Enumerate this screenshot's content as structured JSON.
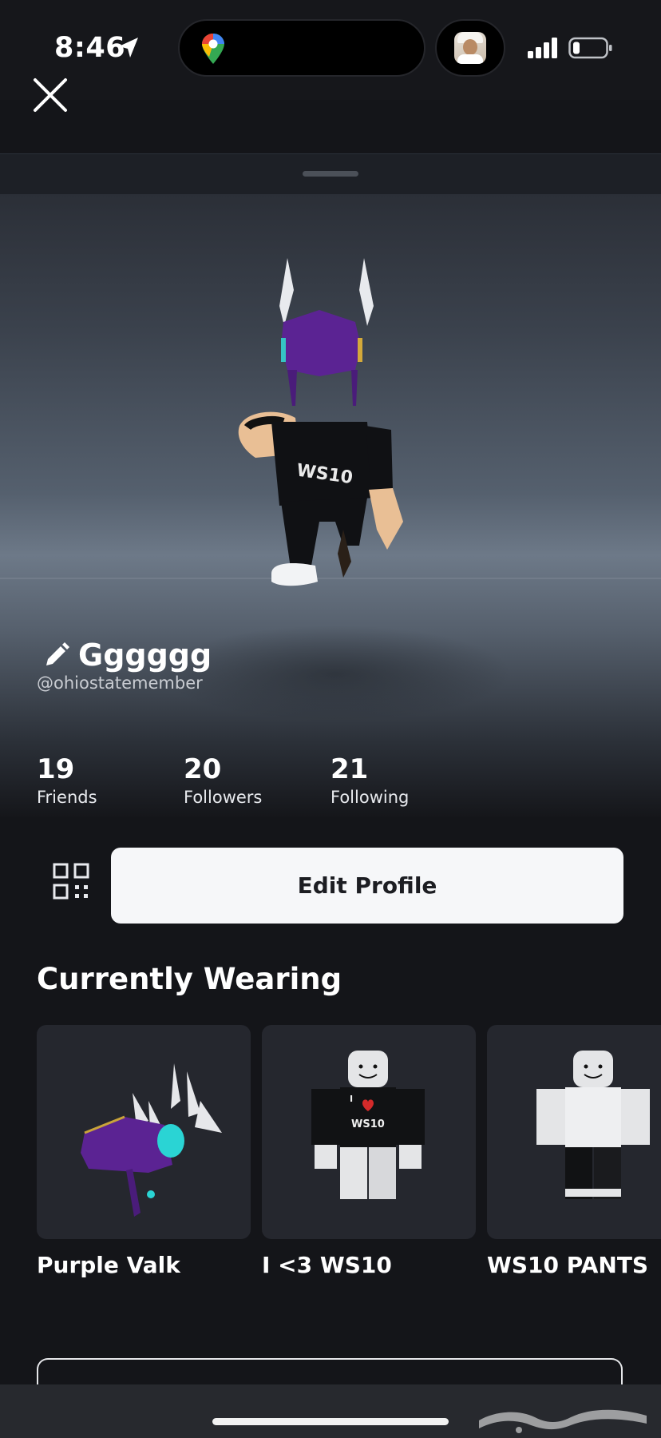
{
  "status_bar": {
    "time": "8:46",
    "icons": [
      "location-arrow-icon",
      "google-maps-icon",
      "contact-avatar-icon",
      "cellular-signal-icon",
      "battery-icon"
    ]
  },
  "header": {
    "close_icon": "close-icon"
  },
  "profile": {
    "display_name": "Gggggg",
    "username": "@ohiostatemember",
    "stats": [
      {
        "value": "19",
        "label": "Friends"
      },
      {
        "value": "20",
        "label": "Followers"
      },
      {
        "value": "21",
        "label": "Following"
      }
    ]
  },
  "actions": {
    "qr_icon": "qr-code-icon",
    "edit_label": "Edit Profile"
  },
  "wearing": {
    "title": "Currently Wearing",
    "items": [
      {
        "name": "Purple Valk",
        "thumb": "purple-valk-helm"
      },
      {
        "name": "I <3 WS10",
        "thumb": "ws10-shirt-avatar",
        "shirt_text": "WS10"
      },
      {
        "name": "WS10 PANTS",
        "thumb": "ws10-pants-avatar"
      }
    ]
  },
  "avatar": {
    "shirt_text": "WS10"
  },
  "colors": {
    "background": "#141519",
    "button_bg": "#f6f7f9",
    "helm_purple": "#5b2393",
    "helm_teal": "#2ad4d4"
  }
}
